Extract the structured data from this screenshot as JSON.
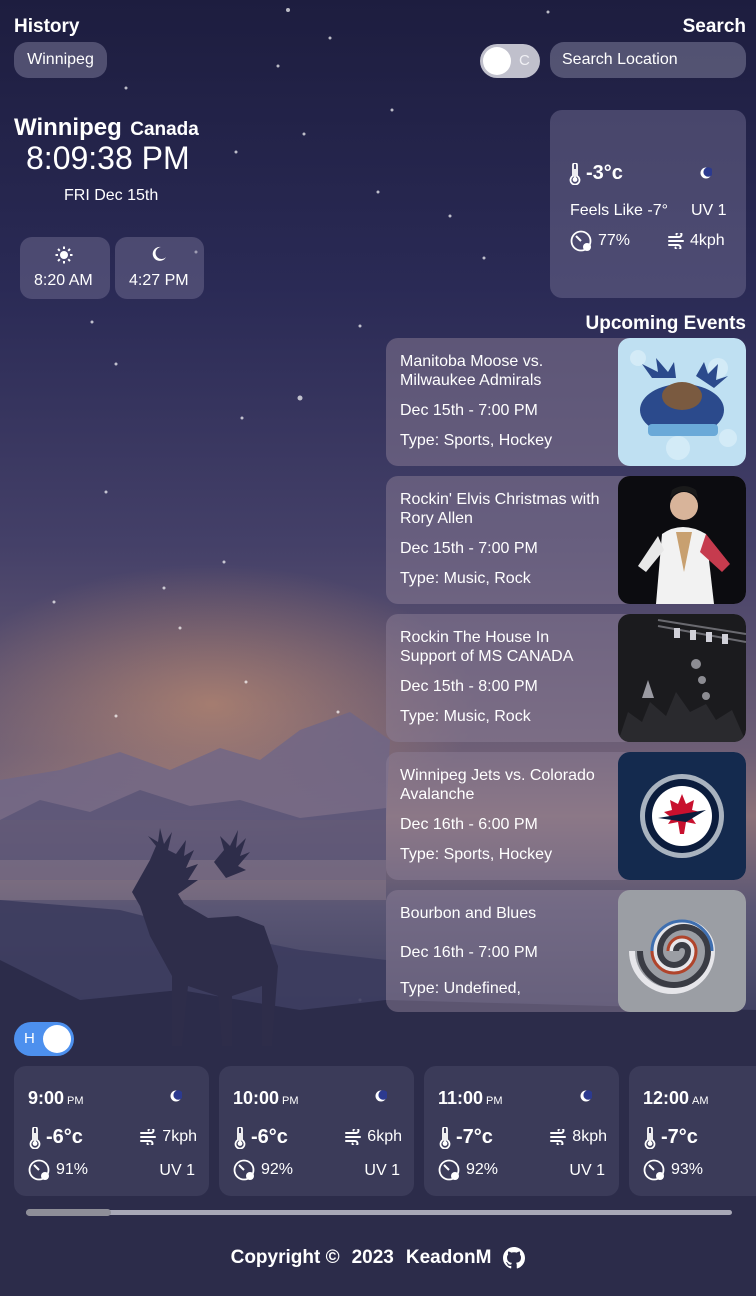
{
  "header": {
    "history_label": "History",
    "history_items": [
      "Winnipeg"
    ],
    "search_label": "Search",
    "unit_toggle_label": "C",
    "search_placeholder": "Search Location"
  },
  "location": {
    "city": "Winnipeg",
    "country": "Canada",
    "time": "8:09:38 PM",
    "date": "FRI Dec 15th",
    "sunrise": "8:20 AM",
    "sunset": "4:27 PM"
  },
  "current": {
    "temp": "-3°c",
    "feels_like": "Feels Like -7°",
    "uv": "UV 1",
    "humidity": "77%",
    "wind": "4kph",
    "condition_icon": "moon-icon"
  },
  "events": {
    "title": "Upcoming Events",
    "items": [
      {
        "name": "Manitoba Moose vs. Milwaukee Admirals",
        "date": "Dec 15th - 7:00 PM",
        "type": "Type: Sports, Hockey",
        "thumb": "moose-logo"
      },
      {
        "name": "Rockin' Elvis Christmas with Rory Allen",
        "date": "Dec 15th - 7:00 PM",
        "type": "Type: Music, Rock",
        "thumb": "elvis-photo"
      },
      {
        "name": "Rockin The House In Support of MS CANADA",
        "date": "Dec 15th - 8:00 PM",
        "type": "Type: Music, Rock",
        "thumb": "concert-photo"
      },
      {
        "name": "Winnipeg Jets vs. Colorado Avalanche",
        "date": "Dec 16th - 6:00 PM",
        "type": "Type: Sports, Hockey",
        "thumb": "jets-logo"
      },
      {
        "name": "Bourbon and Blues",
        "date": "Dec 16th - 7:00 PM",
        "type": "Type: Undefined,",
        "thumb": "swirl-art"
      }
    ]
  },
  "hourly": {
    "toggle_label": "H",
    "items": [
      {
        "time": "9:00",
        "ampm": "PM",
        "temp": "-6°c",
        "wind": "7kph",
        "humidity": "91%",
        "uv": "UV 1"
      },
      {
        "time": "10:00",
        "ampm": "PM",
        "temp": "-6°c",
        "wind": "6kph",
        "humidity": "92%",
        "uv": "UV 1"
      },
      {
        "time": "11:00",
        "ampm": "PM",
        "temp": "-7°c",
        "wind": "8kph",
        "humidity": "92%",
        "uv": "UV 1"
      },
      {
        "time": "12:00",
        "ampm": "AM",
        "temp": "-7°c",
        "wind": "",
        "humidity": "93%",
        "uv": ""
      }
    ],
    "scroll_position": 0.12
  },
  "footer": {
    "copyright": "Copyright ©",
    "year": "2023",
    "author": "KeadonM",
    "icon": "github-icon"
  },
  "colors": {
    "toggle_accent": "#4d90ee",
    "card_bg": "#7b7596"
  }
}
